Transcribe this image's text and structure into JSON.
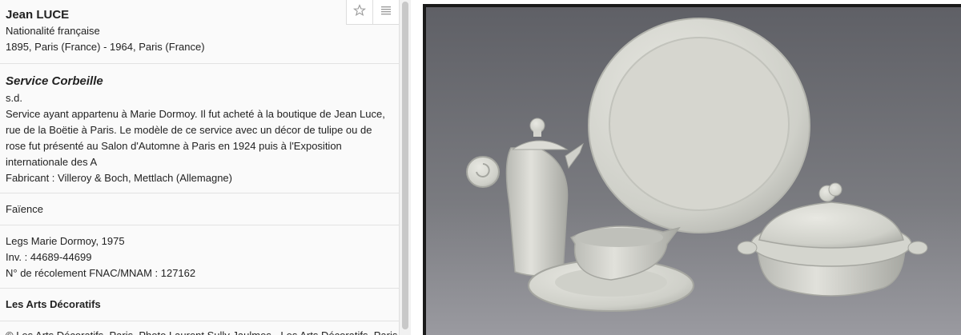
{
  "toolbar": {
    "favorite_icon": "star-outline-icon",
    "menu_icon": "list-lines-icon"
  },
  "artist": {
    "name": "Jean LUCE",
    "nationality": "Nationalité française",
    "dates": "1895, Paris (France) - 1964, Paris (France)"
  },
  "work": {
    "title": "Service Corbeille",
    "date": "s.d.",
    "description": "Service ayant appartenu à Marie Dormoy. Il fut acheté à la boutique de Jean Luce, rue de la Boëtie à Paris. Le modèle de ce service avec un décor de tulipe ou de rose fut présenté au Salon d'Automne à Paris en 1924 puis à l'Exposition internationale des A",
    "manufacturer": "Fabricant : Villeroy & Boch, Mettlach (Allemagne)"
  },
  "material": "Faïence",
  "provenance": {
    "legs": "Legs Marie Dormoy, 1975",
    "inventory": "Inv. : 44689-44699",
    "recolement": "N° de récolement FNAC/MNAM : 127162"
  },
  "museum": "Les Arts Décoratifs",
  "credit": "© Les Arts Décoratifs, Paris. Photo Laurent Sully Jaulmes - Les Arts Décoratifs, Paris. Tous droits réservés",
  "image": {
    "subject": "faience-tableware-set",
    "colors": {
      "background": "#6f6f74",
      "ceramic": "#d9d9d2",
      "frame": "#1a1a1a"
    }
  }
}
